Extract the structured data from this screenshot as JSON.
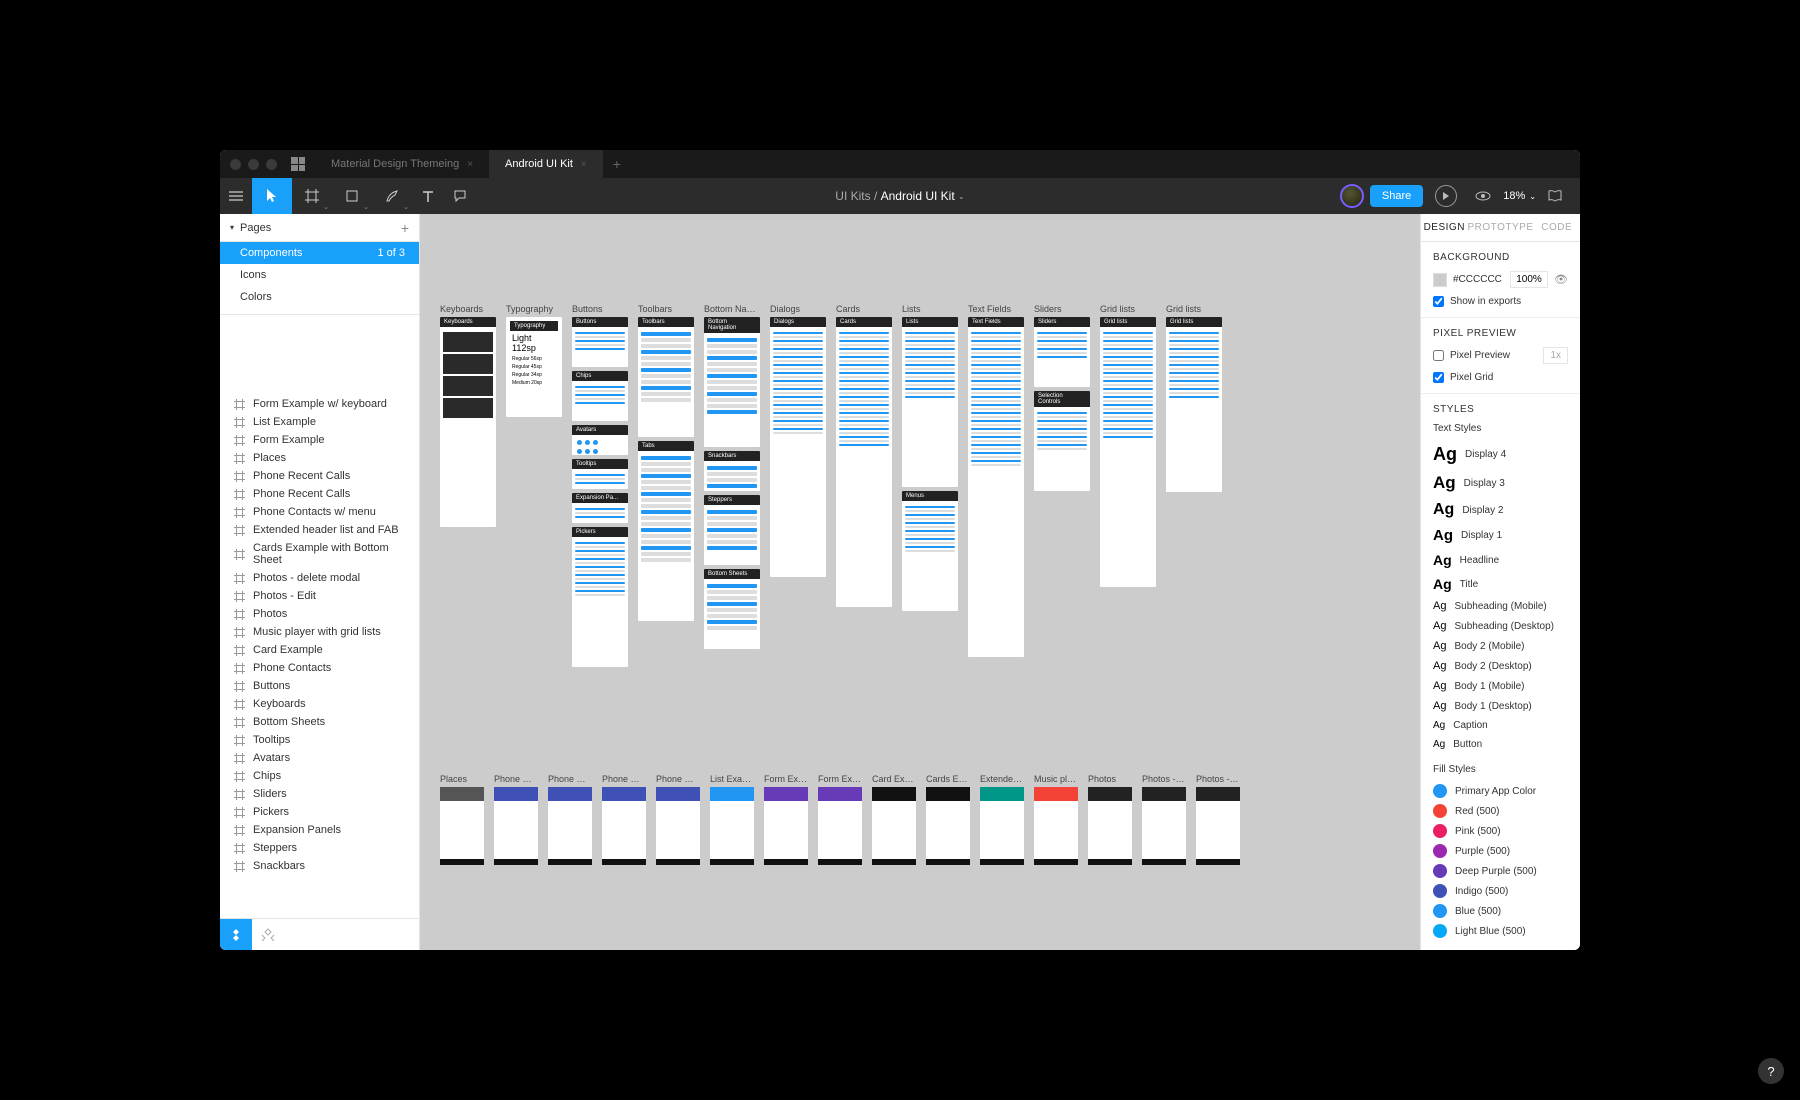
{
  "tabs": [
    {
      "label": "Material Design Themeing",
      "active": false
    },
    {
      "label": "Android UI Kit",
      "active": true
    }
  ],
  "breadcrumb": {
    "parent": "UI Kits",
    "current": "Android UI Kit"
  },
  "share_label": "Share",
  "zoom": "18%",
  "pages": {
    "title": "Pages",
    "items": [
      {
        "name": "Components",
        "count": "1 of 3",
        "selected": true
      },
      {
        "name": "Icons",
        "selected": false
      },
      {
        "name": "Colors",
        "selected": false
      }
    ]
  },
  "layers": [
    "Form Example w/ keyboard",
    "List Example",
    "Form Example",
    "Places",
    "Phone Recent Calls",
    "Phone Recent Calls",
    "Phone Contacts w/ menu",
    "Extended header list and FAB",
    "Cards Example with Bottom Sheet",
    "Photos - delete modal",
    "Photos - Edit",
    "Photos",
    "Music player with grid lists",
    "Card Example",
    "Phone Contacts",
    "Buttons",
    "Keyboards",
    "Bottom Sheets",
    "Tooltips",
    "Avatars",
    "Chips",
    "Sliders",
    "Pickers",
    "Expansion Panels",
    "Steppers",
    "Snackbars"
  ],
  "canvas_row1": [
    {
      "label": "Keyboards",
      "sections": [
        "Keyboards"
      ]
    },
    {
      "label": "Typography",
      "sections": [
        "Typography"
      ],
      "typo": true
    },
    {
      "label": "Buttons",
      "sections": [
        "Buttons",
        "Chips",
        "Avatars",
        "Tooltips",
        "Expansion Pa...",
        "Pickers"
      ]
    },
    {
      "label": "Toolbars",
      "sections": [
        "Toolbars",
        "Tabs"
      ]
    },
    {
      "label": "Bottom Navig...",
      "sections": [
        "Bottom Navigation",
        "Snackbars",
        "Steppers",
        "Bottom Sheets"
      ]
    },
    {
      "label": "Dialogs",
      "sections": [
        "Dialogs"
      ]
    },
    {
      "label": "Cards",
      "sections": [
        "Cards"
      ]
    },
    {
      "label": "Lists",
      "sections": [
        "Lists",
        "Menus"
      ]
    },
    {
      "label": "Text Fields",
      "sections": [
        "Text Fields"
      ]
    },
    {
      "label": "Sliders",
      "sections": [
        "Sliders",
        "Selection Controls"
      ]
    },
    {
      "label": "Grid lists",
      "sections": [
        "Grid lists"
      ]
    },
    {
      "label": "Grid lists",
      "sections": [
        "Grid lists"
      ]
    }
  ],
  "canvas_row2": [
    "Places",
    "Phone Co...",
    "Phone Co...",
    "Phone Re...",
    "Phone Re...",
    "List Exam...",
    "Form Exa...",
    "Form Exa...",
    "Card Exa...",
    "Cards Exa...",
    "Extended ...",
    "Music pla...",
    "Photos",
    "Photos - E...",
    "Photos - d..."
  ],
  "typography": {
    "heading": "Light 112sp",
    "lines": [
      "Regular 56sp",
      "Regular 45sp",
      "Regular 34sp",
      "Medium 20sp"
    ]
  },
  "right": {
    "tabs": [
      "DESIGN",
      "PROTOTYPE",
      "CODE"
    ],
    "background": {
      "title": "BACKGROUND",
      "hex": "#CCCCCC",
      "opacity": "100%",
      "show_exports": "Show in exports"
    },
    "pixel_preview": {
      "title": "PIXEL PREVIEW",
      "preview_label": "Pixel Preview",
      "grid_label": "Pixel Grid",
      "mult": "1x"
    },
    "styles": {
      "title": "STYLES",
      "text_title": "Text Styles",
      "text_styles": [
        "Display 4",
        "Display 3",
        "Display 2",
        "Display 1",
        "Headline",
        "Title",
        "Subheading (Mobile)",
        "Subheading (Desktop)",
        "Body 2 (Mobile)",
        "Body 2 (Desktop)",
        "Body 1 (Mobile)",
        "Body 1 (Desktop)",
        "Caption",
        "Button"
      ],
      "fill_title": "Fill Styles",
      "fill_styles": [
        {
          "name": "Primary App Color",
          "color": "#2196f3"
        },
        {
          "name": "Red (500)",
          "color": "#f44336"
        },
        {
          "name": "Pink (500)",
          "color": "#e91e63"
        },
        {
          "name": "Purple (500)",
          "color": "#9c27b0"
        },
        {
          "name": "Deep Purple (500)",
          "color": "#673ab7"
        },
        {
          "name": "Indigo (500)",
          "color": "#3f51b5"
        },
        {
          "name": "Blue (500)",
          "color": "#2196f3"
        },
        {
          "name": "Light Blue (500)",
          "color": "#03a9f4"
        }
      ]
    }
  }
}
